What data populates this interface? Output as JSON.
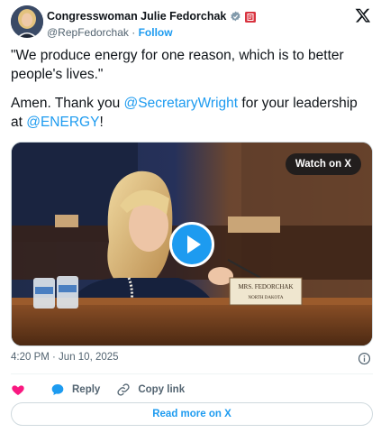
{
  "author": {
    "display_name": "Congresswoman Julie Fedorchak",
    "handle": "@RepFedorchak",
    "separator": "·",
    "follow_label": "Follow"
  },
  "tweet": {
    "paragraph1": "\"We produce energy for one reason, which is to better people's lives.\"",
    "paragraph2_prefix": "Amen. Thank you ",
    "mention1": "@SecretaryWright",
    "paragraph2_middle": " for your leadership at ",
    "mention2": "@ENERGY",
    "paragraph2_suffix": "!"
  },
  "media": {
    "watch_label": "Watch on X",
    "nameplate_line1": "MRS. FEDORCHAK",
    "nameplate_line2": "NORTH DAKOTA"
  },
  "meta": {
    "timestamp": "4:20 PM · Jun 10, 2025"
  },
  "actions": {
    "reply_label": "Reply",
    "copy_link_label": "Copy link"
  },
  "read_more_label": "Read more on X",
  "colors": {
    "accent": "#1d9bf0",
    "like": "#f91880",
    "text": "#0f1419",
    "muted": "#536471"
  },
  "icons": [
    "verified-badge-icon",
    "flag-badge-icon",
    "x-logo-icon",
    "play-icon",
    "info-icon",
    "heart-icon",
    "reply-bubble-icon",
    "link-icon"
  ]
}
